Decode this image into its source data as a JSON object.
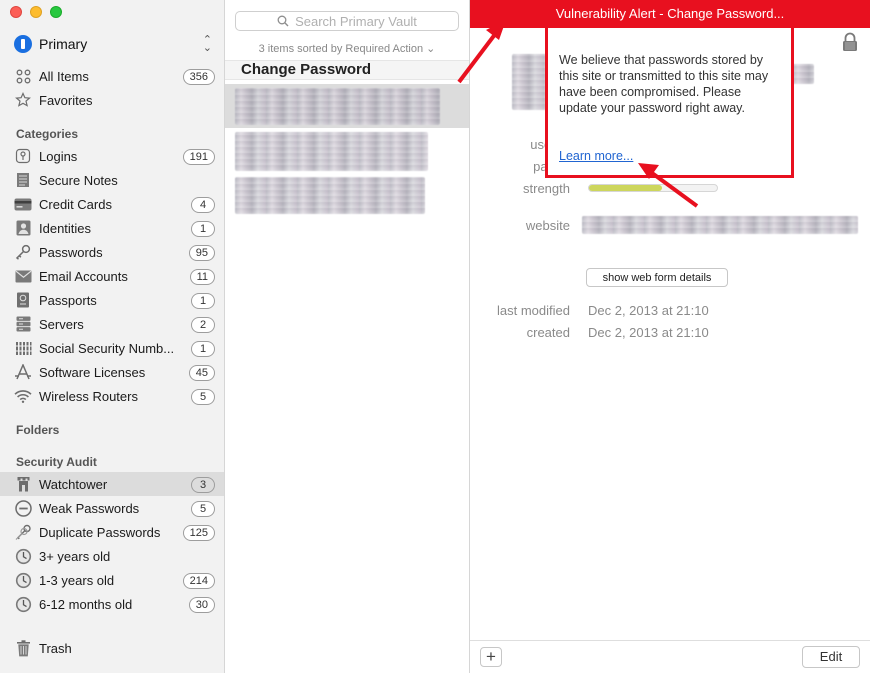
{
  "sidebar": {
    "vault": {
      "name": "Primary"
    },
    "items": [
      {
        "label": "All Items",
        "count": "356",
        "icon": "grid-icon"
      },
      {
        "label": "Favorites",
        "count": "",
        "icon": "star-icon"
      }
    ],
    "categories_heading": "Categories",
    "categories": [
      {
        "label": "Logins",
        "count": "191",
        "icon": "key-icon"
      },
      {
        "label": "Secure Notes",
        "count": "",
        "icon": "note-icon"
      },
      {
        "label": "Credit Cards",
        "count": "4",
        "icon": "credit-card-icon"
      },
      {
        "label": "Identities",
        "count": "1",
        "icon": "person-icon"
      },
      {
        "label": "Passwords",
        "count": "95",
        "icon": "password-key-icon"
      },
      {
        "label": "Email Accounts",
        "count": "11",
        "icon": "envelope-icon"
      },
      {
        "label": "Passports",
        "count": "1",
        "icon": "passport-icon"
      },
      {
        "label": "Servers",
        "count": "2",
        "icon": "server-icon"
      },
      {
        "label": "Social Security Numb...",
        "count": "1",
        "icon": "ssn-icon"
      },
      {
        "label": "Software Licenses",
        "count": "45",
        "icon": "app-icon"
      },
      {
        "label": "Wireless Routers",
        "count": "5",
        "icon": "wifi-icon"
      }
    ],
    "folders_heading": "Folders",
    "audit_heading": "Security Audit",
    "audit": [
      {
        "label": "Watchtower",
        "count": "3",
        "icon": "watchtower-icon"
      },
      {
        "label": "Weak Passwords",
        "count": "5",
        "icon": "weak-icon"
      },
      {
        "label": "Duplicate Passwords",
        "count": "125",
        "icon": "duplicate-icon"
      },
      {
        "label": "3+ years old",
        "count": "",
        "icon": "clock-icon"
      },
      {
        "label": "1-3 years old",
        "count": "214",
        "icon": "clock-icon"
      },
      {
        "label": "6-12 months old",
        "count": "30",
        "icon": "clock-icon"
      }
    ],
    "trash": {
      "label": "Trash",
      "icon": "trash-icon"
    }
  },
  "list": {
    "search_placeholder": "Search Primary Vault",
    "sort_info": "3 items sorted by Required Action",
    "section_title": "Change Password"
  },
  "detail": {
    "alert": "Vulnerability Alert - Change Password...",
    "labels": {
      "username": "userna",
      "password": "passw",
      "strength": "strength",
      "website": "website",
      "last_modified": "last modified",
      "created": "created"
    },
    "strength_fraction": 0.57,
    "show_web_form": "show web form details",
    "last_modified": "Dec 2, 2013 at 21:10",
    "created": "Dec 2, 2013 at 21:10",
    "edit": "Edit"
  },
  "popover": {
    "text": "We believe that passwords stored by this site or transmitted to this site may have been compromised. Please update your password right away.",
    "link": "Learn more..."
  },
  "colors": {
    "alert": "#e8101f",
    "link": "#2165d1",
    "strength": "#cdd65c"
  }
}
